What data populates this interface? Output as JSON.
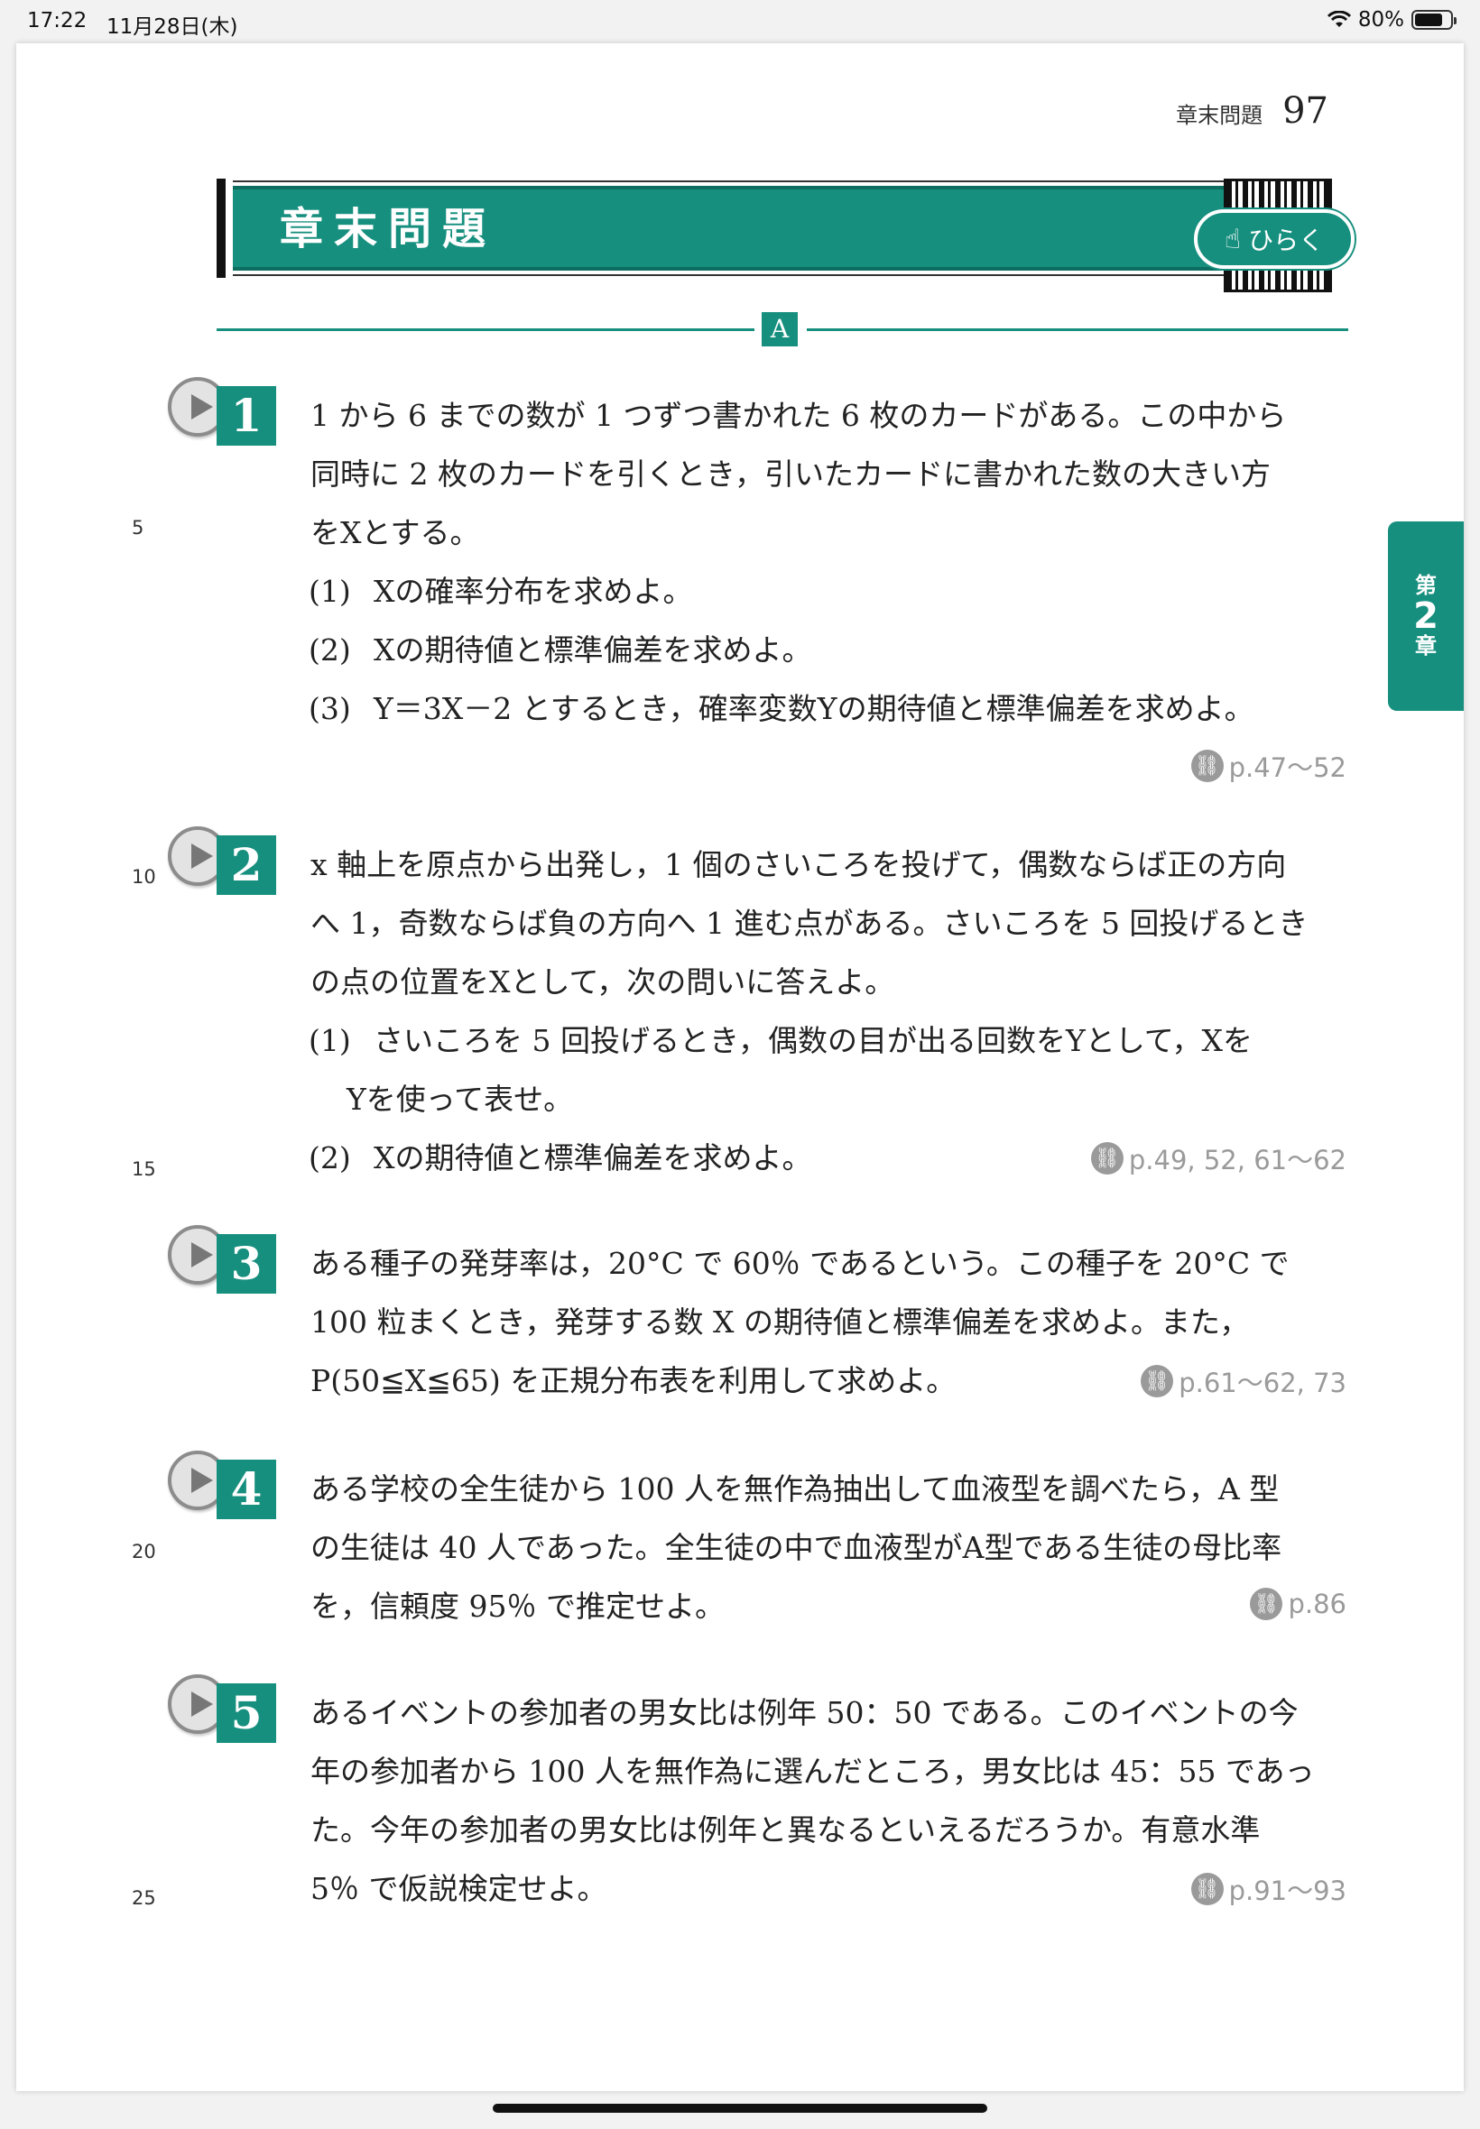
{
  "status": {
    "time": "17:22",
    "date": "11月28日(木)",
    "battery": "80%"
  },
  "running_head": {
    "label": "章末問題",
    "page": "97"
  },
  "title": "章末問題",
  "open_button": "ひらく",
  "section_label": "A",
  "side_tab": {
    "t1": "第",
    "t2": "2",
    "t3": "章"
  },
  "line_numbers": [
    "5",
    "10",
    "15",
    "20",
    "25"
  ],
  "problems": [
    {
      "num": "1",
      "lines": [
        "1 から 6 までの数が 1 つずつ書かれた 6 枚のカードがある。この中から",
        "同時に 2 枚のカードを引くとき，引いたカードに書かれた数の大きい方",
        "をXとする。"
      ],
      "subs": [
        {
          "label": "(1)",
          "text": "Xの確率分布を求めよ。"
        },
        {
          "label": "(2)",
          "text": "Xの期待値と標準偏差を求めよ。"
        },
        {
          "label": "(3)",
          "text": "Y＝3X－2 とするとき，確率変数Yの期待値と標準偏差を求めよ。"
        }
      ],
      "ref": "p.47〜52"
    },
    {
      "num": "2",
      "lines": [
        "x 軸上を原点から出発し，1 個のさいころを投げて，偶数ならば正の方向",
        "へ 1，奇数ならば負の方向へ 1 進む点がある。さいころを 5 回投げるとき",
        "の点の位置をXとして，次の問いに答えよ。"
      ],
      "subs": [
        {
          "label": "(1)",
          "text": "さいころを 5 回投げるとき，偶数の目が出る回数をYとして，Xを"
        },
        {
          "label": "(2)",
          "text": "Xの期待値と標準偏差を求めよ。"
        }
      ],
      "sub1_cont": "Yを使って表せ。",
      "ref": "p.49, 52, 61〜62"
    },
    {
      "num": "3",
      "lines": [
        "ある種子の発芽率は，20°C で 60％ であるという。この種子を 20°C で",
        "100 粒まくとき，発芽する数 X の期待値と標準偏差を求めよ。また，",
        "P(50≦X≦65) を正規分布表を利用して求めよ。"
      ],
      "ref": "p.61〜62, 73"
    },
    {
      "num": "4",
      "lines": [
        "ある学校の全生徒から 100 人を無作為抽出して血液型を調べたら，A 型",
        "の生徒は 40 人であった。全生徒の中で血液型がA型である生徒の母比率",
        "を，信頼度 95％ で推定せよ。"
      ],
      "ref": "p.86"
    },
    {
      "num": "5",
      "lines": [
        "あるイベントの参加者の男女比は例年 50：50 である。このイベントの今",
        "年の参加者から 100 人を無作為に選んだところ，男女比は 45：55 であっ",
        "た。今年の参加者の男女比は例年と異なるといえるだろうか。有意水準",
        "5％ で仮説検定せよ。"
      ],
      "ref": "p.91〜93"
    }
  ]
}
